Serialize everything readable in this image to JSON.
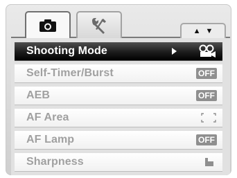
{
  "tabs": [
    {
      "icon": "camera-icon",
      "selected": true
    },
    {
      "icon": "wrench-screwdriver-icon",
      "selected": false
    }
  ],
  "nav": {
    "up": "▲",
    "down": "▼"
  },
  "menu": {
    "items": [
      {
        "label": "Shooting Mode",
        "value_icon": "video-camera-icon",
        "selected": true
      },
      {
        "label": "Self-Timer/Burst",
        "value": "OFF"
      },
      {
        "label": "AEB",
        "value": "OFF"
      },
      {
        "label": "AF Area",
        "value_icon": "af-area-brackets-icon"
      },
      {
        "label": "AF Lamp",
        "value": "OFF"
      },
      {
        "label": "Sharpness",
        "value_icon": "sharpness-icon"
      }
    ]
  }
}
